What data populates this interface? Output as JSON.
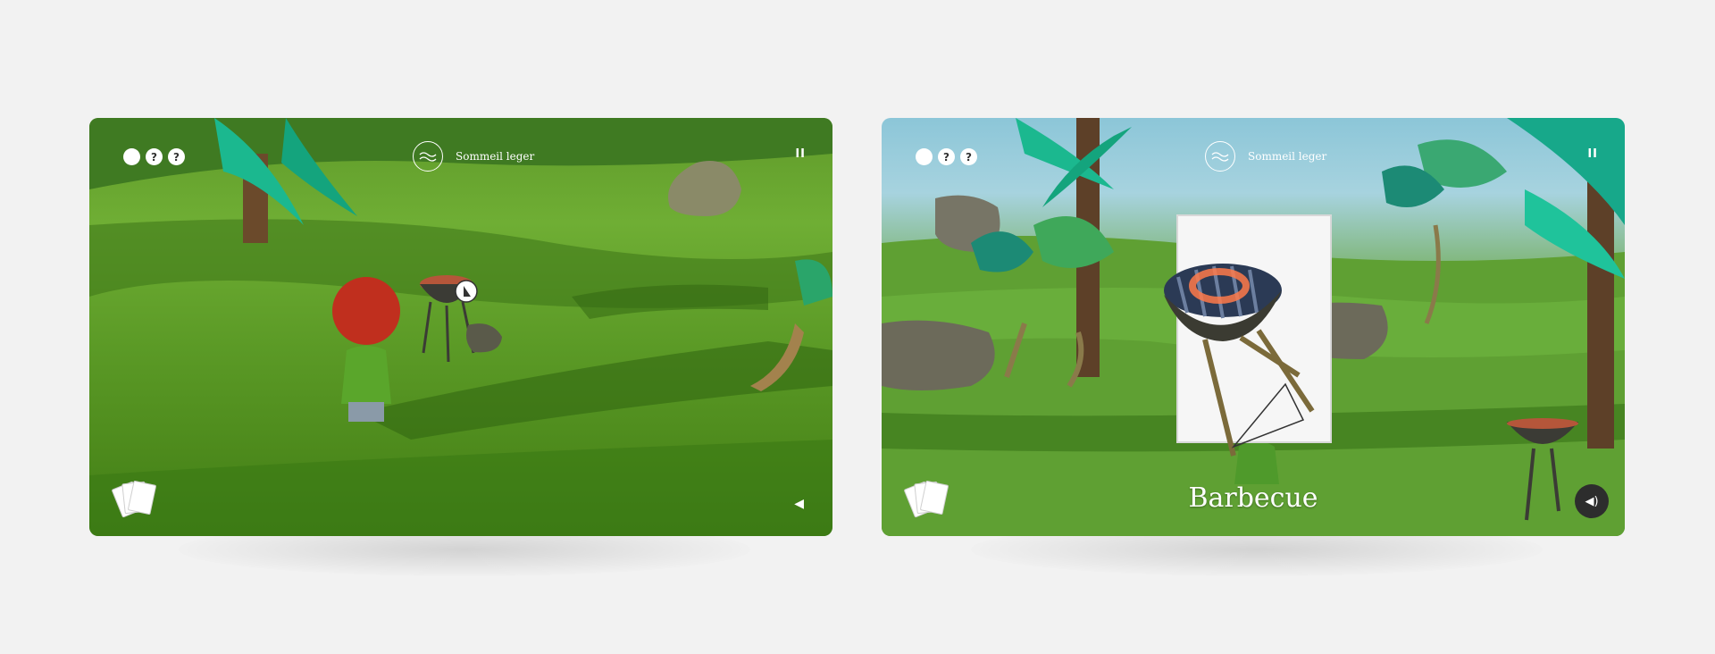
{
  "panels": [
    {
      "hud": {
        "title": "Sommeil leger",
        "indicators": [
          "",
          "?",
          "?"
        ],
        "pause_symbol": "II",
        "sound_symbol": "◀"
      }
    },
    {
      "hud": {
        "title": "Sommeil leger",
        "indicators": [
          "",
          "?",
          "?"
        ],
        "pause_symbol": "II",
        "sound_symbol": "◀)"
      },
      "item_label": "Barbecue"
    }
  ],
  "icons": [
    "wave-icon",
    "cards-icon",
    "pause-icon",
    "speaker-icon",
    "hand-cursor-icon"
  ],
  "colors": {
    "background": "#f2f2f2",
    "hud_text": "#ffffff",
    "grass": "#5b9a26",
    "sky": "#a7d3df"
  }
}
